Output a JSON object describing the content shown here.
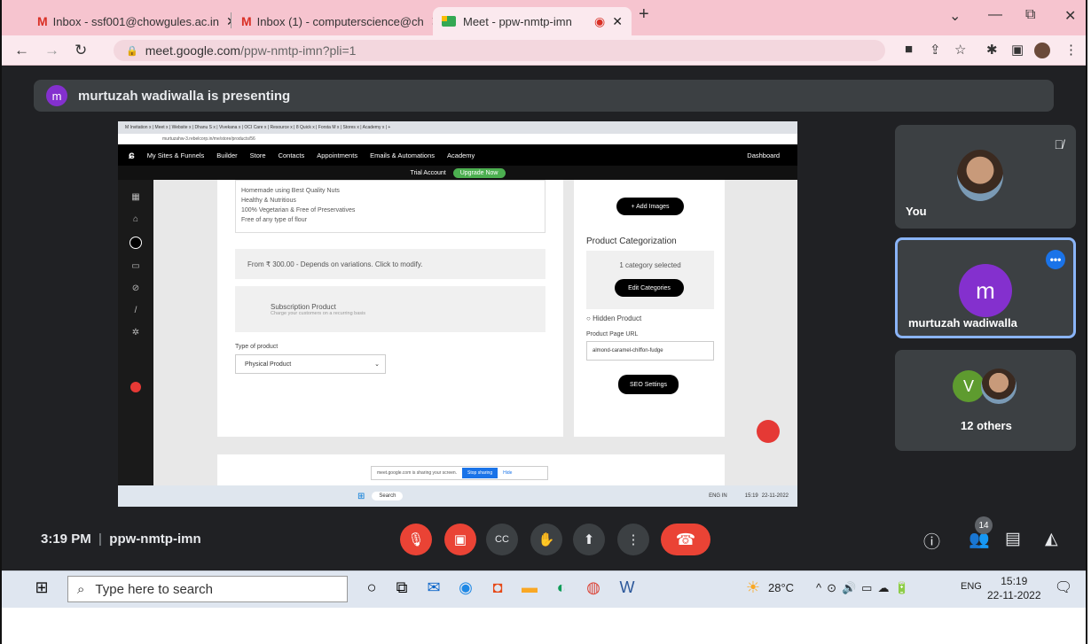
{
  "browser": {
    "tabs": [
      {
        "label": "Inbox - ssf001@chowgules.ac.in"
      },
      {
        "label": "Inbox (1) - computerscience@ch"
      },
      {
        "label": "Meet - ppw-nmtp-imn"
      }
    ],
    "new_tab": "+",
    "url_host": "meet.google.com",
    "url_path": "/ppw-nmtp-imn?pli=1"
  },
  "meet": {
    "presenter_initial": "m",
    "presenting_text": "murtuzah wadiwalla is presenting",
    "tiles": [
      {
        "name": "You"
      },
      {
        "name": "murtuzah wadiwalla",
        "initial": "m"
      },
      {
        "name": "12 others",
        "initial": "V"
      }
    ],
    "time": "3:19 PM",
    "separator": "|",
    "meeting_code": "ppw-nmtp-imn",
    "people_count": "14"
  },
  "shared_screen": {
    "tabs_text": "M Invitation  x | Meet  x | Website  x | Dhanu S  x | Vivekana  x | OCI Care  x | Resource  x | 8 Quick  x | Forsta M  x | Stores  x | Academy  x | +",
    "url": "murtuzahw-3.rebelcorp.in/me/store/products/56",
    "nav": [
      "My Sites & Funnels",
      "Builder",
      "Store",
      "Contacts",
      "Appointments",
      "Emails & Automations",
      "Academy"
    ],
    "dashboard": "Dashboard",
    "trial": "Trial Account",
    "upgrade": "Upgrade Now",
    "bullets": [
      "Homemade using Best Quality Nuts",
      "Healthy & Nutritious",
      "100% Vegetarian & Free of Preservatives",
      "Free of any type of flour"
    ],
    "price_text": "From ₹ 300.00 - Depends on variations. Click to modify.",
    "subscription_title": "Subscription Product",
    "subscription_sub": "Charge your customers on a recurring basis",
    "type_label": "Type of product",
    "type_value": "Physical Product",
    "add_images": "+ Add Images",
    "categorization": "Product Categorization",
    "category_selected": "1 category selected",
    "edit_categories": "Edit Categories",
    "hidden_product": "Hidden Product",
    "page_url_label": "Product Page URL",
    "page_url_value": "almond-caramel-chiffon-fudge",
    "seo": "SEO Settings",
    "share_text": "meet.google.com is sharing your screen.",
    "stop_sharing": "Stop sharing",
    "hide": "Hide",
    "taskbar_search": "Search",
    "lang": "ENG IN",
    "clock_time": "15:19",
    "clock_date": "22-11-2022"
  },
  "taskbar": {
    "search_placeholder": "Type here to search",
    "weather": "28°C",
    "lang": "ENG",
    "time": "15:19",
    "date": "22-11-2022"
  }
}
